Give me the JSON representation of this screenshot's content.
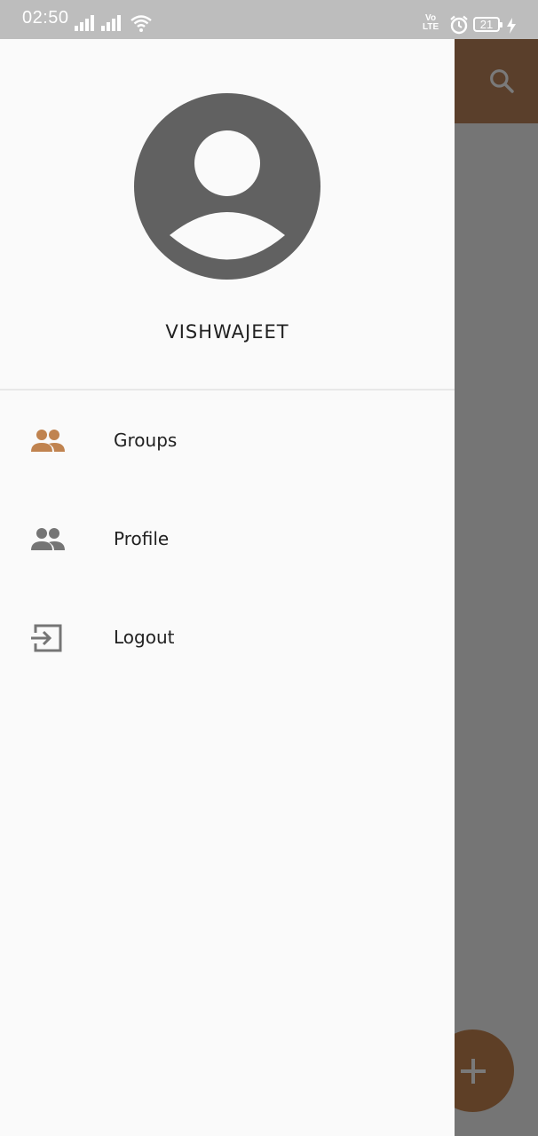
{
  "status_bar": {
    "time": "02:50",
    "network_label": "Vo LTE",
    "battery_level": "21",
    "icons": [
      "signal-icon",
      "signal-icon",
      "wifi-icon",
      "volte-icon",
      "alarm-icon",
      "battery-icon",
      "charging-icon"
    ]
  },
  "drawer": {
    "user_name": "VISHWAJEET",
    "avatar_icon": "account-circle-icon",
    "items": [
      {
        "label": "Groups",
        "icon": "group-icon",
        "icon_color": "#c0834f",
        "selected": true
      },
      {
        "label": "Profile",
        "icon": "group-icon",
        "icon_color": "#757575",
        "selected": false
      },
      {
        "label": "Logout",
        "icon": "logout-icon",
        "icon_color": "#757575",
        "selected": false
      }
    ]
  },
  "toolbar": {
    "search_icon": "search-icon",
    "color": "#5a3f2b"
  },
  "fab": {
    "icon": "plus-icon",
    "color": "#5e3f26"
  },
  "colors": {
    "accent": "#c0834f",
    "drawer_background": "#fafafa",
    "scrim": "#757575",
    "status_bar": "#bdbdbd"
  }
}
